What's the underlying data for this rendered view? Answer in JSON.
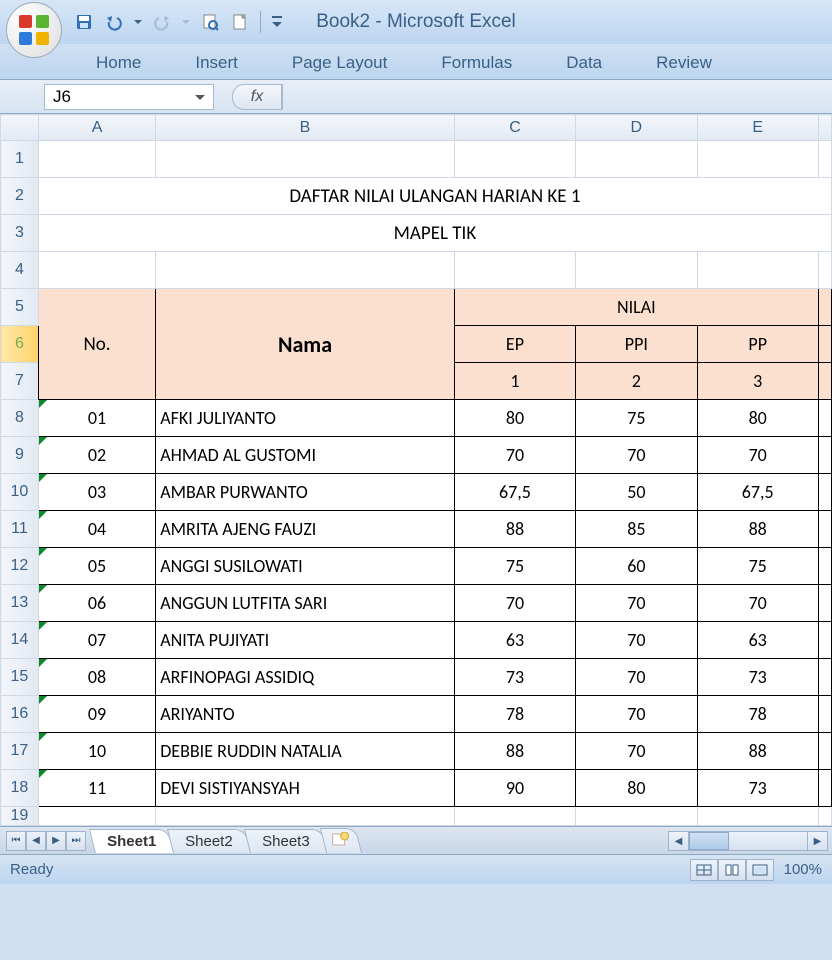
{
  "app": {
    "title": "Book2 - Microsoft Excel"
  },
  "ribbon_tabs": [
    "Home",
    "Insert",
    "Page Layout",
    "Formulas",
    "Data",
    "Review"
  ],
  "namebox": "J6",
  "fx_label": "fx",
  "columns": [
    "A",
    "B",
    "C",
    "D",
    "E"
  ],
  "row_numbers": [
    "1",
    "2",
    "3",
    "4",
    "5",
    "6",
    "7",
    "8",
    "9",
    "10",
    "11",
    "12",
    "13",
    "14",
    "15",
    "16",
    "17",
    "18",
    "19"
  ],
  "sheet": {
    "title_row2": "DAFTAR NILAI ULANGAN HARIAN KE 1",
    "title_row3": "MAPEL TIK",
    "hdr_no": "No.",
    "hdr_nama": "Nama",
    "hdr_nilai": "NILAI",
    "sub": {
      "c": "EP",
      "d": "PPI",
      "e": "PP"
    },
    "nums": {
      "c": "1",
      "d": "2",
      "e": "3"
    },
    "rows": [
      {
        "no": "01",
        "nama": "AFKI JULIYANTO",
        "ep": "80",
        "ppi": "75",
        "pp": "80"
      },
      {
        "no": "02",
        "nama": "AHMAD AL GUSTOMI",
        "ep": "70",
        "ppi": "70",
        "pp": "70"
      },
      {
        "no": "03",
        "nama": "AMBAR PURWANTO",
        "ep": "67,5",
        "ppi": "50",
        "pp": "67,5"
      },
      {
        "no": "04",
        "nama": "AMRITA AJENG FAUZI",
        "ep": "88",
        "ppi": "85",
        "pp": "88"
      },
      {
        "no": "05",
        "nama": "ANGGI SUSILOWATI",
        "ep": "75",
        "ppi": "60",
        "pp": "75"
      },
      {
        "no": "06",
        "nama": "ANGGUN LUTFITA SARI",
        "ep": "70",
        "ppi": "70",
        "pp": "70"
      },
      {
        "no": "07",
        "nama": "ANITA PUJIYATI",
        "ep": "63",
        "ppi": "70",
        "pp": "63"
      },
      {
        "no": "08",
        "nama": "ARFINOPAGI ASSIDIQ",
        "ep": "73",
        "ppi": "70",
        "pp": "73"
      },
      {
        "no": "09",
        "nama": "ARIYANTO",
        "ep": "78",
        "ppi": "70",
        "pp": "78"
      },
      {
        "no": "10",
        "nama": "DEBBIE RUDDIN NATALIA",
        "ep": "88",
        "ppi": "70",
        "pp": "88"
      },
      {
        "no": "11",
        "nama": "DEVI SISTIYANSYAH",
        "ep": "90",
        "ppi": "80",
        "pp": "73"
      }
    ]
  },
  "sheet_tabs": [
    "Sheet1",
    "Sheet2",
    "Sheet3"
  ],
  "status": {
    "ready": "Ready",
    "zoom": "100%"
  },
  "colors": {
    "header_bg": "#fbe0cf"
  },
  "selected_cell": "J6",
  "chart_data": {
    "type": "table",
    "title": "DAFTAR NILAI ULANGAN HARIAN KE 1 — MAPEL TIK",
    "columns": [
      "No.",
      "Nama",
      "EP (1)",
      "PPI (2)",
      "PP (3)"
    ],
    "rows": [
      [
        "01",
        "AFKI JULIYANTO",
        80,
        75,
        80
      ],
      [
        "02",
        "AHMAD AL GUSTOMI",
        70,
        70,
        70
      ],
      [
        "03",
        "AMBAR PURWANTO",
        67.5,
        50,
        67.5
      ],
      [
        "04",
        "AMRITA AJENG FAUZI",
        88,
        85,
        88
      ],
      [
        "05",
        "ANGGI SUSILOWATI",
        75,
        60,
        75
      ],
      [
        "06",
        "ANGGUN LUTFITA SARI",
        70,
        70,
        70
      ],
      [
        "07",
        "ANITA PUJIYATI",
        63,
        70,
        63
      ],
      [
        "08",
        "ARFINOPAGI ASSIDIQ",
        73,
        70,
        73
      ],
      [
        "09",
        "ARIYANTO",
        78,
        70,
        78
      ],
      [
        "10",
        "DEBBIE RUDDIN NATALIA",
        88,
        70,
        88
      ],
      [
        "11",
        "DEVI SISTIYANSYAH",
        90,
        80,
        73
      ]
    ]
  }
}
